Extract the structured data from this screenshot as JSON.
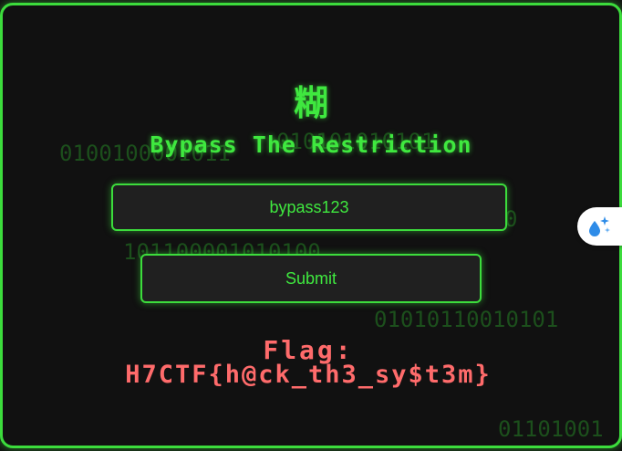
{
  "background_binary": [
    "0100100001011",
    "010101010101",
    "101100001010100",
    "0",
    "01010110010101",
    "01101001"
  ],
  "logo": {
    "glyph": "糊"
  },
  "title": "Bypass The Restriction",
  "form": {
    "input_value": "bypass123",
    "submit_label": "Submit"
  },
  "flag": {
    "label": "Flag:",
    "value": "H7CTF{h@ck_th3_sy$t3m}"
  },
  "side_widget": {
    "icon": "sparkle-droplet-icon"
  },
  "colors": {
    "accent_green": "#3cdc3c",
    "flag_red": "#ff6b6b",
    "background": "#111111",
    "input_background": "#202020"
  }
}
